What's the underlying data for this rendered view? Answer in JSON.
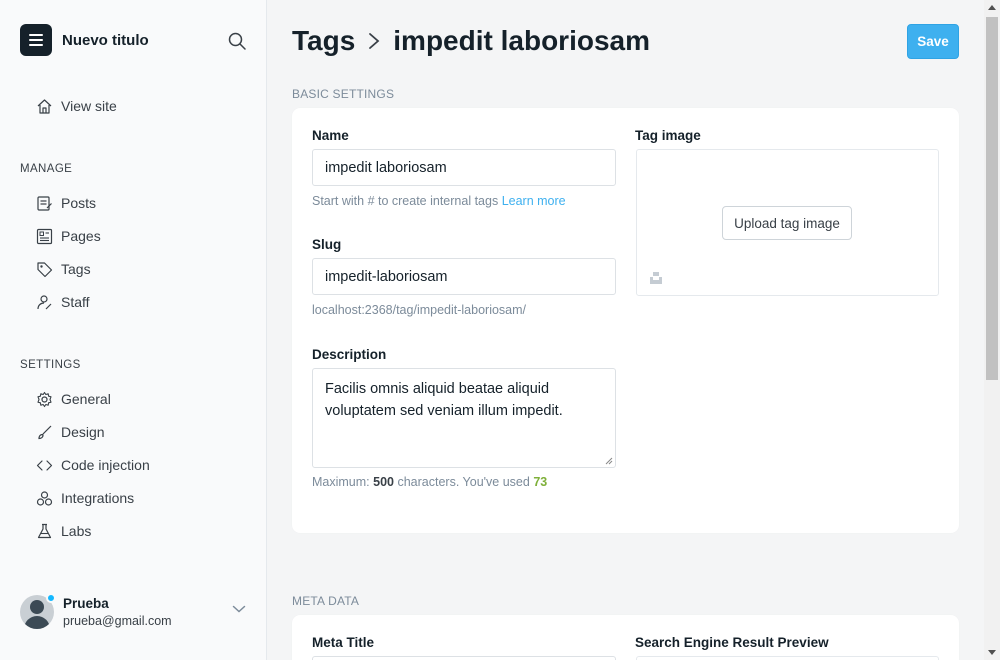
{
  "sidebar": {
    "brand_title": "Nuevo titulo",
    "view_site": "View site",
    "manage_label": "MANAGE",
    "manage_items": [
      "Posts",
      "Pages",
      "Tags",
      "Staff"
    ],
    "settings_label": "SETTINGS",
    "settings_items": [
      "General",
      "Design",
      "Code injection",
      "Integrations",
      "Labs"
    ],
    "user": {
      "name": "Prueba",
      "email": "prueba@gmail.com"
    }
  },
  "header": {
    "breadcrumb_parent": "Tags",
    "breadcrumb_current": "impedit laboriosam",
    "save_label": "Save"
  },
  "basic": {
    "section_label": "BASIC SETTINGS",
    "name_label": "Name",
    "name_value": "impedit laboriosam",
    "name_hint": "Start with # to create internal tags",
    "learn_more": "Learn more",
    "slug_label": "Slug",
    "slug_value": "impedit-laboriosam",
    "slug_url": "localhost:2368/tag/impedit-laboriosam/",
    "description_label": "Description",
    "description_value": "Facilis omnis aliquid beatae aliquid voluptatem sed veniam illum impedit.",
    "max_prefix": "Maximum:",
    "max_value": "500",
    "max_middle": "characters. You've used",
    "used_value": "73",
    "image_label": "Tag image",
    "upload_label": "Upload tag image"
  },
  "meta": {
    "section_label": "META DATA",
    "meta_title_label": "Meta Title",
    "preview_label": "Search Engine Result Preview"
  },
  "colors": {
    "accent": "#3eb0ef",
    "count": "#7fb03a",
    "status_dot": "#14b8ff"
  }
}
